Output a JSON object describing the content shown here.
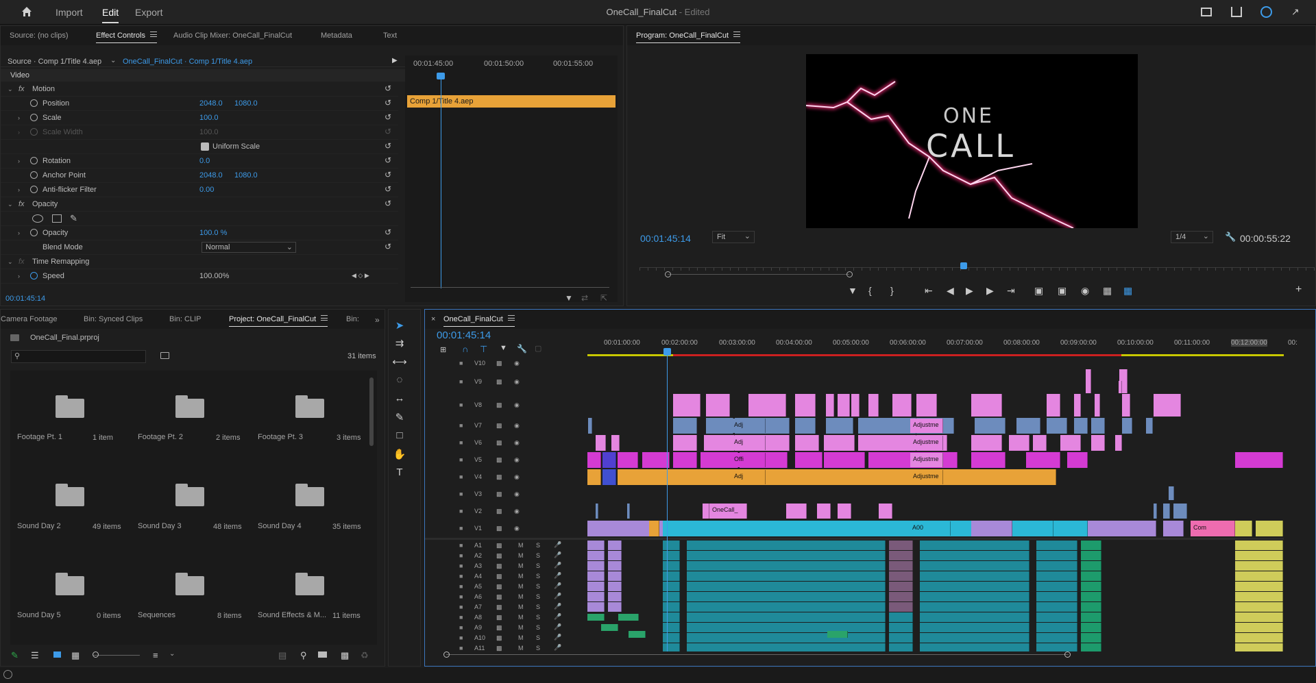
{
  "app": {
    "nav": [
      "Import",
      "Edit",
      "Export"
    ],
    "title": "OneCall_FinalCut",
    "title_suffix": "- Edited"
  },
  "source_panel": {
    "tabs": [
      "Source: (no clips)",
      "Effect Controls",
      "Audio Clip Mixer: OneCall_FinalCut",
      "Metadata",
      "Text"
    ],
    "source_label": "Source · Comp 1/Title 4.aep",
    "sequence_label": "OneCall_FinalCut · Comp 1/Title 4.aep",
    "ruler": [
      "00:01:45:00",
      "00:01:50:00",
      "00:01:55:00"
    ],
    "clip_label": "Comp 1/Title 4.aep",
    "section_video": "Video",
    "motion": "Motion",
    "position_label": "Position",
    "position_x": "2048.0",
    "position_y": "1080.0",
    "scale_label": "Scale",
    "scale_value": "100.0",
    "scale_width_label": "Scale Width",
    "scale_width_value": "100.0",
    "uniform_scale": "Uniform Scale",
    "rotation_label": "Rotation",
    "rotation_value": "0.0",
    "anchor_label": "Anchor Point",
    "anchor_x": "2048.0",
    "anchor_y": "1080.0",
    "antiflicker_label": "Anti-flicker Filter",
    "antiflicker_value": "0.00",
    "opacity_section": "Opacity",
    "opacity_label": "Opacity",
    "opacity_value": "100.0 %",
    "blend_label": "Blend Mode",
    "blend_value": "Normal",
    "time_remap": "Time Remapping",
    "speed_label": "Speed",
    "speed_value": "100.00%",
    "timecode": "00:01:45:14"
  },
  "program_panel": {
    "tab": "Program: OneCall_FinalCut",
    "frame_text_top": "ONE",
    "frame_text_bottom": "CALL",
    "timecode": "00:01:45:14",
    "zoom": "Fit",
    "resolution": "1/4",
    "duration": "00:00:55:22"
  },
  "project_panel": {
    "tabs": [
      "Camera Footage",
      "Bin: Synced Clips",
      "Bin: CLIP",
      "Project: OneCall_FinalCut",
      "Bin:"
    ],
    "project_file": "OneCall_Final.prproj",
    "item_count": "31 items",
    "bins": [
      {
        "name": "Footage Pt. 1",
        "count": "1 item"
      },
      {
        "name": "Footage Pt. 2",
        "count": "2 items"
      },
      {
        "name": "Footage Pt. 3",
        "count": "3 items"
      },
      {
        "name": "Sound Day 2",
        "count": "49 items"
      },
      {
        "name": "Sound Day 3",
        "count": "48 items"
      },
      {
        "name": "Sound Day 4",
        "count": "35 items"
      },
      {
        "name": "Sound Day 5",
        "count": "0 items"
      },
      {
        "name": "Sequences",
        "count": "8 items"
      },
      {
        "name": "Sound Effects & M...",
        "count": "11 items"
      }
    ]
  },
  "timeline": {
    "tab": "OneCall_FinalCut",
    "timecode": "00:01:45:14",
    "ruler": [
      "00:01:00:00",
      "00:02:00:00",
      "00:03:00:00",
      "00:04:00:00",
      "00:05:00:00",
      "00:06:00:00",
      "00:07:00:00",
      "00:08:00:00",
      "00:09:00:00",
      "00:10:00:00",
      "00:11:00:00",
      "00:12:00:00",
      "00:"
    ],
    "video_tracks": [
      "V10",
      "V9",
      "V8",
      "V7",
      "V6",
      "V5",
      "V4",
      "V3",
      "V2",
      "V1"
    ],
    "audio_tracks": [
      "A1",
      "A2",
      "A3",
      "A4",
      "A5",
      "A6",
      "A7",
      "A8",
      "A9",
      "A10",
      "A11"
    ],
    "clip_labels": [
      "Adj",
      "Adj",
      "Offi",
      "Adj",
      "Adjustme",
      "Adjustme",
      "Adjustme",
      "Adjustme",
      "OneCall_",
      "A00",
      "Com"
    ],
    "track_buttons": {
      "mute": "M",
      "solo": "S"
    }
  },
  "colors": {
    "accent": "#3d9be9",
    "pink": "#e486e0",
    "magenta": "#d43bd3",
    "blue": "#6d8cbd",
    "orange": "#e8a238",
    "cyan": "#2bb8d6",
    "lavender": "#a889d8",
    "audio": "#1f8a9a",
    "yellow": "#cfcc5a",
    "green": "#2aa36a"
  }
}
